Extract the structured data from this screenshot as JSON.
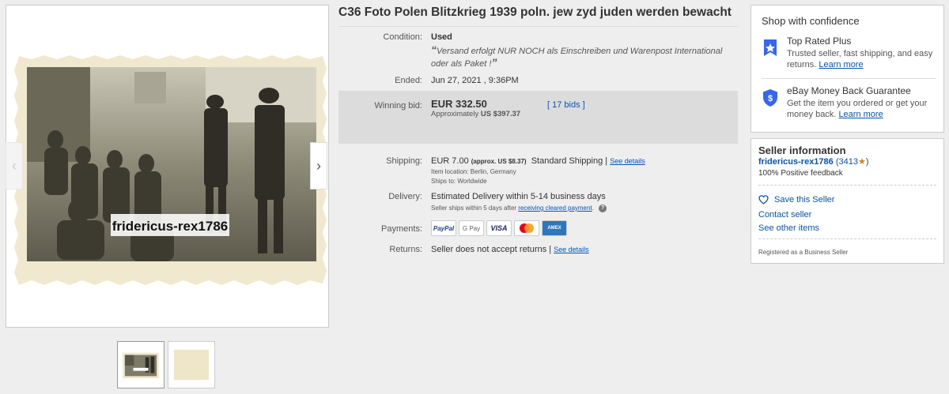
{
  "gallery": {
    "watermark": "fridericus-rex1786",
    "prev_arrow": "‹",
    "next_arrow": "›"
  },
  "listing": {
    "title": "C36 Foto Polen Blitzkrieg 1939 poln. jew zyd juden werden bewacht",
    "condition_label": "Condition:",
    "condition_value": "Used",
    "condition_note": "Versand erfolgt NUR NOCH als Einschreiben und Warenpost International oder als Paket !",
    "ended_label": "Ended:",
    "ended_value": "Jun 27, 2021 , 9:36PM",
    "winning_label": "Winning bid:",
    "winning_value": "EUR 332.50",
    "approx_label": "Approximately",
    "approx_value": "US $397.37",
    "bids": "17 bids",
    "shipping_label": "Shipping:",
    "shipping_price": "EUR 7.00",
    "shipping_approx": "(approx. US $8.37)",
    "shipping_method": "Standard Shipping",
    "see_details": "See details",
    "item_location": "Item location:  Berlin, Germany",
    "ships_to": "Ships to:  Worldwide",
    "delivery_label": "Delivery:",
    "delivery_value": "Estimated Delivery within 5-14 business days",
    "delivery_note": "Seller ships within 5 days after",
    "delivery_link": "receiving cleared payment",
    "payments_label": "Payments:",
    "payments": [
      "PayPal",
      "G Pay",
      "VISA",
      "",
      "AMEX"
    ],
    "returns_label": "Returns:",
    "returns_value": "Seller does not accept returns |",
    "returns_link": "See details"
  },
  "shop": {
    "heading": "Shop with confidence",
    "top_rated_title": "Top Rated Plus",
    "top_rated_desc": "Trusted seller, fast shipping, and easy returns.",
    "learn_more": "Learn more",
    "mbg_title": "eBay Money Back Guarantee",
    "mbg_desc": "Get the item you ordered or get your money back.",
    "learn_more2": "Learn more"
  },
  "seller": {
    "heading": "Seller information",
    "name": "fridericus-rex1786",
    "score": "(3413",
    "score_close": ")",
    "feedback": "100% Positive feedback",
    "save": "Save this Seller",
    "contact": "Contact seller",
    "other": "See other items",
    "registered": "Registered as a Business Seller"
  },
  "colors": {
    "link": "#0654ba",
    "bid_box": "#dcdcdc",
    "star": "#e07b1a"
  }
}
